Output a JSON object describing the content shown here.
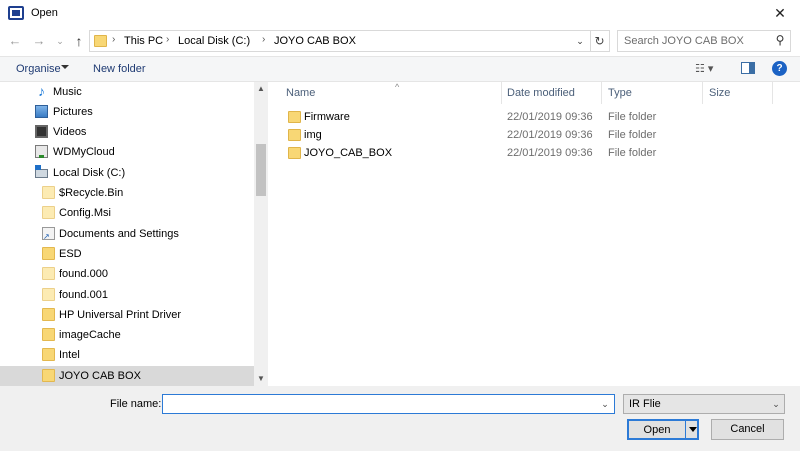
{
  "window": {
    "title": "Open",
    "close_glyph": "✕"
  },
  "address": {
    "crumbs": [
      "This PC",
      "Local Disk (C:)",
      "JOYO CAB BOX"
    ],
    "separator": "›"
  },
  "search": {
    "placeholder": "Search JOYO CAB BOX"
  },
  "toolbar": {
    "organise_label": "Organise",
    "new_folder_label": "New folder",
    "view_glyph": "☷ ▾",
    "help_glyph": "?"
  },
  "nav": {
    "items": [
      {
        "label": "Music",
        "icon": "music-icon"
      },
      {
        "label": "Pictures",
        "icon": "pictures-icon"
      },
      {
        "label": "Videos",
        "icon": "videos-icon"
      },
      {
        "label": "WDMyCloud",
        "icon": "network-drive-icon"
      },
      {
        "label": "Local Disk (C:)",
        "icon": "local-disk-icon"
      },
      {
        "label": "$Recycle.Bin",
        "icon": "folder-light-icon"
      },
      {
        "label": "Config.Msi",
        "icon": "folder-light-icon"
      },
      {
        "label": "Documents and Settings",
        "icon": "shortcut-folder-icon"
      },
      {
        "label": "ESD",
        "icon": "folder-icon"
      },
      {
        "label": "found.000",
        "icon": "folder-light-icon"
      },
      {
        "label": "found.001",
        "icon": "folder-light-icon"
      },
      {
        "label": "HP Universal Print Driver",
        "icon": "folder-icon"
      },
      {
        "label": "imageCache",
        "icon": "folder-icon"
      },
      {
        "label": "Intel",
        "icon": "folder-icon"
      },
      {
        "label": "JOYO CAB BOX",
        "icon": "folder-icon",
        "selected": true
      }
    ]
  },
  "files": {
    "columns": [
      "Name",
      "Date modified",
      "Type",
      "Size"
    ],
    "rows": [
      {
        "name": "Firmware",
        "date": "22/01/2019 09:36",
        "type": "File folder",
        "size": ""
      },
      {
        "name": "img",
        "date": "22/01/2019 09:36",
        "type": "File folder",
        "size": ""
      },
      {
        "name": "JOYO_CAB_BOX",
        "date": "22/01/2019 09:36",
        "type": "File folder",
        "size": ""
      }
    ]
  },
  "bottom": {
    "filename_label": "File name:",
    "filename_value": "",
    "filter_value": "IR Flie",
    "open_label": "Open",
    "cancel_label": "Cancel"
  },
  "colors": {
    "accent": "#2c7ad6",
    "folder": "#f8d775",
    "selected_bg": "#d9d9d9"
  }
}
